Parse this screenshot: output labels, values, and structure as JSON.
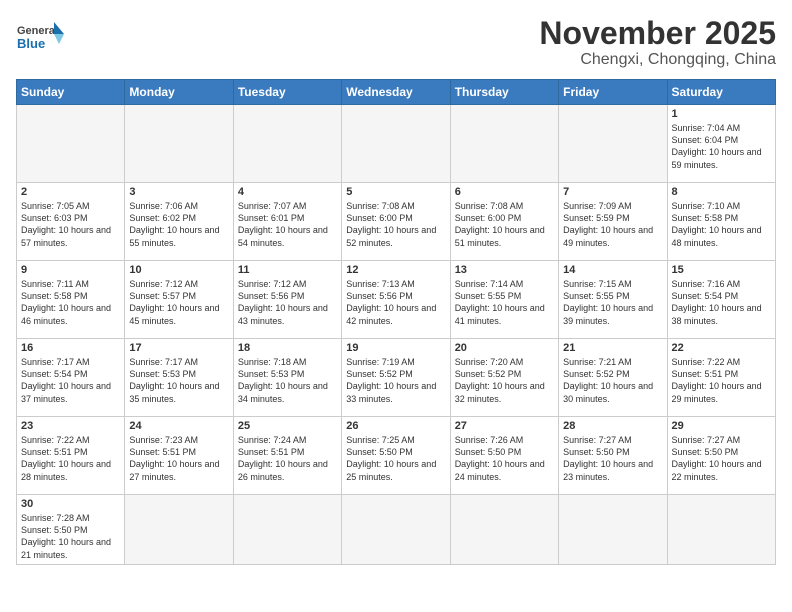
{
  "logo": {
    "general": "General",
    "blue": "Blue"
  },
  "title": "November 2025",
  "location": "Chengxi, Chongqing, China",
  "days_of_week": [
    "Sunday",
    "Monday",
    "Tuesday",
    "Wednesday",
    "Thursday",
    "Friday",
    "Saturday"
  ],
  "weeks": [
    [
      {
        "day": "",
        "info": ""
      },
      {
        "day": "",
        "info": ""
      },
      {
        "day": "",
        "info": ""
      },
      {
        "day": "",
        "info": ""
      },
      {
        "day": "",
        "info": ""
      },
      {
        "day": "",
        "info": ""
      },
      {
        "day": "1",
        "info": "Sunrise: 7:04 AM\nSunset: 6:04 PM\nDaylight: 10 hours and 59 minutes."
      }
    ],
    [
      {
        "day": "2",
        "info": "Sunrise: 7:05 AM\nSunset: 6:03 PM\nDaylight: 10 hours and 57 minutes."
      },
      {
        "day": "3",
        "info": "Sunrise: 7:06 AM\nSunset: 6:02 PM\nDaylight: 10 hours and 55 minutes."
      },
      {
        "day": "4",
        "info": "Sunrise: 7:07 AM\nSunset: 6:01 PM\nDaylight: 10 hours and 54 minutes."
      },
      {
        "day": "5",
        "info": "Sunrise: 7:08 AM\nSunset: 6:00 PM\nDaylight: 10 hours and 52 minutes."
      },
      {
        "day": "6",
        "info": "Sunrise: 7:08 AM\nSunset: 6:00 PM\nDaylight: 10 hours and 51 minutes."
      },
      {
        "day": "7",
        "info": "Sunrise: 7:09 AM\nSunset: 5:59 PM\nDaylight: 10 hours and 49 minutes."
      },
      {
        "day": "8",
        "info": "Sunrise: 7:10 AM\nSunset: 5:58 PM\nDaylight: 10 hours and 48 minutes."
      }
    ],
    [
      {
        "day": "9",
        "info": "Sunrise: 7:11 AM\nSunset: 5:58 PM\nDaylight: 10 hours and 46 minutes."
      },
      {
        "day": "10",
        "info": "Sunrise: 7:12 AM\nSunset: 5:57 PM\nDaylight: 10 hours and 45 minutes."
      },
      {
        "day": "11",
        "info": "Sunrise: 7:12 AM\nSunset: 5:56 PM\nDaylight: 10 hours and 43 minutes."
      },
      {
        "day": "12",
        "info": "Sunrise: 7:13 AM\nSunset: 5:56 PM\nDaylight: 10 hours and 42 minutes."
      },
      {
        "day": "13",
        "info": "Sunrise: 7:14 AM\nSunset: 5:55 PM\nDaylight: 10 hours and 41 minutes."
      },
      {
        "day": "14",
        "info": "Sunrise: 7:15 AM\nSunset: 5:55 PM\nDaylight: 10 hours and 39 minutes."
      },
      {
        "day": "15",
        "info": "Sunrise: 7:16 AM\nSunset: 5:54 PM\nDaylight: 10 hours and 38 minutes."
      }
    ],
    [
      {
        "day": "16",
        "info": "Sunrise: 7:17 AM\nSunset: 5:54 PM\nDaylight: 10 hours and 37 minutes."
      },
      {
        "day": "17",
        "info": "Sunrise: 7:17 AM\nSunset: 5:53 PM\nDaylight: 10 hours and 35 minutes."
      },
      {
        "day": "18",
        "info": "Sunrise: 7:18 AM\nSunset: 5:53 PM\nDaylight: 10 hours and 34 minutes."
      },
      {
        "day": "19",
        "info": "Sunrise: 7:19 AM\nSunset: 5:52 PM\nDaylight: 10 hours and 33 minutes."
      },
      {
        "day": "20",
        "info": "Sunrise: 7:20 AM\nSunset: 5:52 PM\nDaylight: 10 hours and 32 minutes."
      },
      {
        "day": "21",
        "info": "Sunrise: 7:21 AM\nSunset: 5:52 PM\nDaylight: 10 hours and 30 minutes."
      },
      {
        "day": "22",
        "info": "Sunrise: 7:22 AM\nSunset: 5:51 PM\nDaylight: 10 hours and 29 minutes."
      }
    ],
    [
      {
        "day": "23",
        "info": "Sunrise: 7:22 AM\nSunset: 5:51 PM\nDaylight: 10 hours and 28 minutes."
      },
      {
        "day": "24",
        "info": "Sunrise: 7:23 AM\nSunset: 5:51 PM\nDaylight: 10 hours and 27 minutes."
      },
      {
        "day": "25",
        "info": "Sunrise: 7:24 AM\nSunset: 5:51 PM\nDaylight: 10 hours and 26 minutes."
      },
      {
        "day": "26",
        "info": "Sunrise: 7:25 AM\nSunset: 5:50 PM\nDaylight: 10 hours and 25 minutes."
      },
      {
        "day": "27",
        "info": "Sunrise: 7:26 AM\nSunset: 5:50 PM\nDaylight: 10 hours and 24 minutes."
      },
      {
        "day": "28",
        "info": "Sunrise: 7:27 AM\nSunset: 5:50 PM\nDaylight: 10 hours and 23 minutes."
      },
      {
        "day": "29",
        "info": "Sunrise: 7:27 AM\nSunset: 5:50 PM\nDaylight: 10 hours and 22 minutes."
      }
    ],
    [
      {
        "day": "30",
        "info": "Sunrise: 7:28 AM\nSunset: 5:50 PM\nDaylight: 10 hours and 21 minutes."
      },
      {
        "day": "",
        "info": ""
      },
      {
        "day": "",
        "info": ""
      },
      {
        "day": "",
        "info": ""
      },
      {
        "day": "",
        "info": ""
      },
      {
        "day": "",
        "info": ""
      },
      {
        "day": "",
        "info": ""
      }
    ]
  ]
}
